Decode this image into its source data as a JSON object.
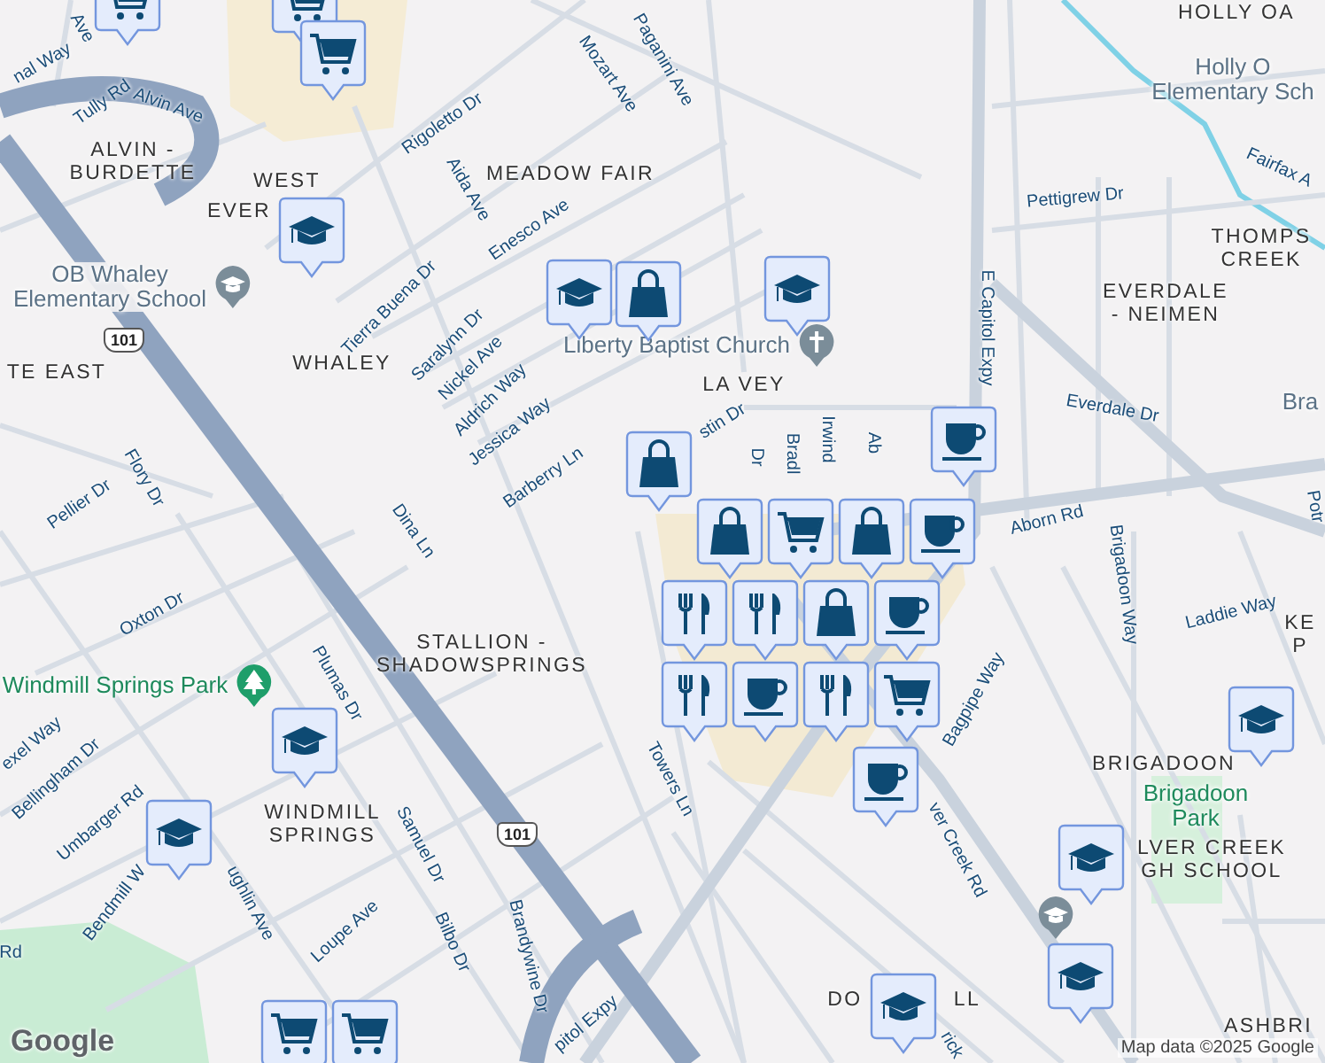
{
  "map": {
    "area_labels": [
      {
        "lines": [
          "ALVIN -",
          "BURDETTE"
        ]
      },
      {
        "lines": [
          "WEST"
        ]
      },
      {
        "lines": [
          "EVER"
        ]
      },
      {
        "lines": [
          "MEADOW FAIR"
        ]
      },
      {
        "lines": [
          "WHALEY"
        ]
      },
      {
        "lines": [
          "TE EAST"
        ]
      },
      {
        "lines": [
          "LA VEY"
        ]
      },
      {
        "lines": [
          "HOLLY OA"
        ]
      },
      {
        "lines": [
          "THOMPS",
          "CREEK"
        ]
      },
      {
        "lines": [
          "EVERDALE",
          "- NEIMEN"
        ]
      },
      {
        "lines": [
          "KE",
          "P"
        ]
      },
      {
        "lines": [
          "STALLION -",
          "SHADOWSPRINGS"
        ]
      },
      {
        "lines": [
          "WINDMILL",
          "SPRINGS"
        ]
      },
      {
        "lines": [
          "BRIGADOON"
        ]
      },
      {
        "lines": [
          "LVER CREEK",
          "GH SCHOOL"
        ]
      },
      {
        "lines": [
          "DO"
        ]
      },
      {
        "lines": [
          "LL"
        ]
      },
      {
        "lines": [
          "ASHBRI"
        ]
      }
    ],
    "place_labels": [
      {
        "kind": "school",
        "lines": [
          "OB Whaley",
          "Elementary School"
        ]
      },
      {
        "kind": "church",
        "lines": [
          "Liberty Baptist Church"
        ]
      },
      {
        "kind": "plain",
        "lines": [
          "Holly O",
          "Elementary Sch"
        ]
      },
      {
        "kind": "park",
        "lines": [
          "Windmill Springs Park"
        ]
      },
      {
        "kind": "parkname",
        "lines": [
          "Brigadoon",
          "Park"
        ]
      },
      {
        "kind": "plain",
        "lines": [
          "Bra"
        ]
      },
      {
        "kind": "schoolicon"
      }
    ],
    "street_labels": [
      "Tully Rd",
      "Alvin Ave",
      "nal Way",
      "Ave",
      "Rigoletto Dr",
      "Aida Ave",
      "Enesco Ave",
      "Mozart Ave",
      "Paganini Ave",
      "Tierra Buena Dr",
      "Saralynn Dr",
      "Nickel Ave",
      "Aldrich Way",
      "Jessica Way",
      "Barberry Ln",
      "Flory Dr",
      "Pellier Dr",
      "Dina Ln",
      "Oxton Dr",
      "Plumas Dr",
      "exel Way",
      "Bellingham Dr",
      "Umbarger Rd",
      "Bendmill W",
      "ughlin Ave",
      "Samuel Dr",
      "Loupe Ave",
      "Bilbo Dr",
      "Brandywine Dr",
      "Rd",
      "pitol Expy",
      "Towers Ln",
      "Bagpipe Way",
      "ver Creek Rd",
      "rick",
      "E Capitol Expy",
      "Pettigrew Dr",
      "Everdale Dr",
      "Fairfax A",
      "Aborn Rd",
      "Brigadoon Way",
      "Laddie Way",
      "stin Dr",
      "Dr",
      "Bradl",
      "Irwind",
      "Ab",
      "Potr"
    ],
    "highway_shields": [
      "101",
      "101"
    ],
    "pins": [
      {
        "kind": "cart"
      },
      {
        "kind": "cart"
      },
      {
        "kind": "cart"
      },
      {
        "kind": "school"
      },
      {
        "kind": "school"
      },
      {
        "kind": "bag"
      },
      {
        "kind": "school"
      },
      {
        "kind": "cafe"
      },
      {
        "kind": "bag"
      },
      {
        "kind": "bag"
      },
      {
        "kind": "cart"
      },
      {
        "kind": "bag"
      },
      {
        "kind": "cafe"
      },
      {
        "kind": "food"
      },
      {
        "kind": "cafe"
      },
      {
        "kind": "bag"
      },
      {
        "kind": "cart"
      },
      {
        "kind": "food"
      },
      {
        "kind": "food"
      },
      {
        "kind": "food"
      },
      {
        "kind": "cafe"
      },
      {
        "kind": "cafe"
      },
      {
        "kind": "school"
      },
      {
        "kind": "school"
      },
      {
        "kind": "school"
      },
      {
        "kind": "school"
      },
      {
        "kind": "school"
      },
      {
        "kind": "school"
      },
      {
        "kind": "cart"
      },
      {
        "kind": "cart"
      }
    ],
    "logo": "Google",
    "attribution": "Map data ©2025 Google"
  }
}
